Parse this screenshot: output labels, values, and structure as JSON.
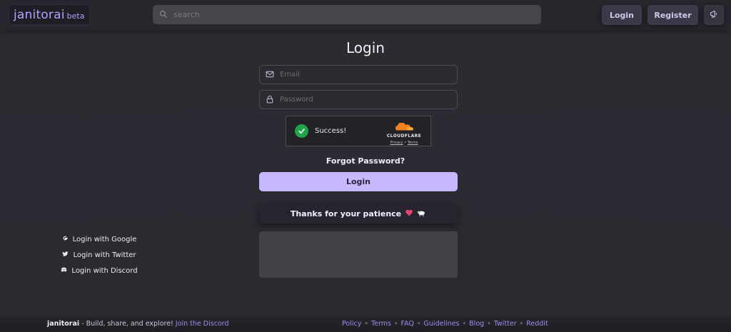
{
  "header": {
    "brand_name": "janitorai",
    "brand_tag": "beta",
    "search_placeholder": "search",
    "login_label": "Login",
    "register_label": "Register",
    "announce_icon": "megaphone-icon"
  },
  "main": {
    "title": "Login",
    "email_placeholder": "Email",
    "password_placeholder": "Password",
    "captcha": {
      "status": "Success!",
      "provider": "CLOUDFLARE",
      "privacy": "Privacy",
      "link_sep": "•",
      "terms": "Terms"
    },
    "forgot_label": "Forgot Password?",
    "login_button": "Login",
    "patience_text": "Thanks for your patience",
    "social": {
      "google": "Login with Google",
      "twitter": "Login with Twitter",
      "discord": "Login with Discord"
    }
  },
  "footer": {
    "brand": "janitorai",
    "tagline": " - Build, share, and explore! ",
    "discord_link": "Join the Discord",
    "links": [
      "Policy",
      "Terms",
      "FAQ",
      "Guidelines",
      "Blog",
      "Twitter",
      "Reddit"
    ],
    "separator": "•"
  },
  "colors": {
    "accent": "#c7b8ff",
    "brand": "#b6a0ff",
    "background": "#2c2b32",
    "success": "#1fa44a",
    "cloudflare": "#f48120"
  }
}
